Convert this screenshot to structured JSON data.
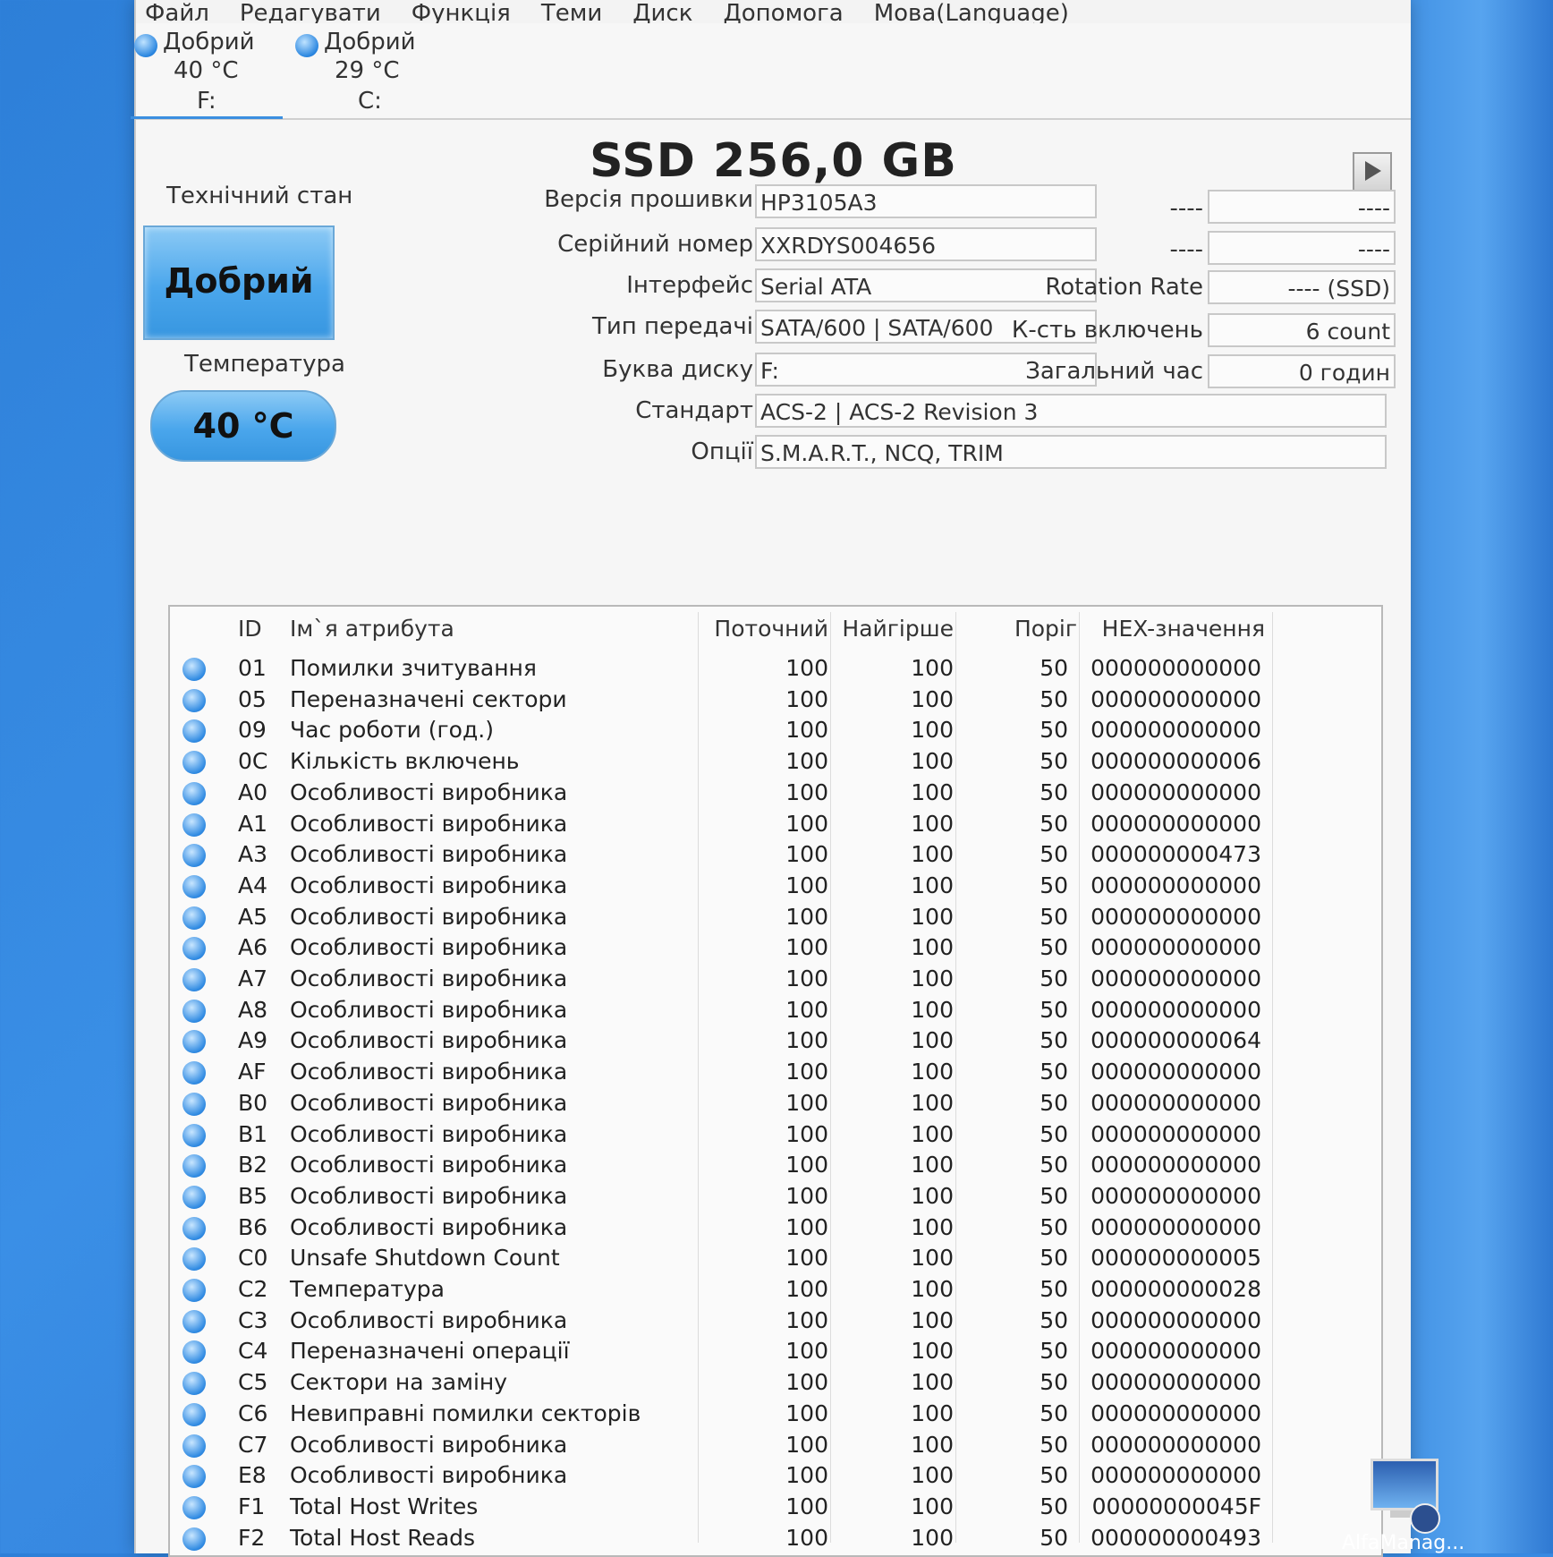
{
  "menu": [
    "Файл",
    "Редагувати",
    "Функція",
    "Теми",
    "Диск",
    "Допомога",
    "Мова(Language)"
  ],
  "drives": [
    {
      "status": "Добрий",
      "temp": "40 °C",
      "letter": "F:"
    },
    {
      "status": "Добрий",
      "temp": "29 °C",
      "letter": "C:"
    }
  ],
  "model": "SSD 256,0 GB",
  "health": {
    "label": "Технічний стан",
    "value": "Добрий"
  },
  "temperature": {
    "label": "Температура",
    "value": "40 °C"
  },
  "info": {
    "firmware_label": "Версія прошивки",
    "firmware": "HP3105A3",
    "serial_label": "Серійний номер",
    "serial": "XXRDYS004656",
    "interface_label": "Інтерфейс",
    "interface": "Serial ATA",
    "transfer_label": "Тип передачі",
    "transfer": "SATA/600 | SATA/600",
    "letter_label": "Буква диску",
    "letter": "F:",
    "standard_label": "Стандарт",
    "standard": "ACS-2 | ACS-2 Revision 3",
    "options_label": "Опції",
    "options": "S.M.A.R.T., NCQ, TRIM",
    "extra1_label": "----",
    "extra1": "----",
    "extra2_label": "----",
    "extra2": "----",
    "rotation_label": "Rotation Rate",
    "rotation": "---- (SSD)",
    "power_count_label": "К-сть включень",
    "power_count": "6 count",
    "total_time_label": "Загальний час",
    "total_time": "0 годин"
  },
  "table": {
    "headers": {
      "id": "ID",
      "name": "Ім`я атрибута",
      "current": "Поточний",
      "worst": "Найгірше",
      "threshold": "Поріг",
      "raw": "HEX-значення"
    },
    "rows": [
      {
        "id": "01",
        "name": "Помилки зчитування",
        "current": "100",
        "worst": "100",
        "threshold": "50",
        "raw": "000000000000"
      },
      {
        "id": "05",
        "name": "Переназначені сектори",
        "current": "100",
        "worst": "100",
        "threshold": "50",
        "raw": "000000000000"
      },
      {
        "id": "09",
        "name": "Час роботи (год.)",
        "current": "100",
        "worst": "100",
        "threshold": "50",
        "raw": "000000000000"
      },
      {
        "id": "0C",
        "name": "Кількість включень",
        "current": "100",
        "worst": "100",
        "threshold": "50",
        "raw": "000000000006"
      },
      {
        "id": "A0",
        "name": "Особливості виробника",
        "current": "100",
        "worst": "100",
        "threshold": "50",
        "raw": "000000000000"
      },
      {
        "id": "A1",
        "name": "Особливості виробника",
        "current": "100",
        "worst": "100",
        "threshold": "50",
        "raw": "000000000000"
      },
      {
        "id": "A3",
        "name": "Особливості виробника",
        "current": "100",
        "worst": "100",
        "threshold": "50",
        "raw": "000000000473"
      },
      {
        "id": "A4",
        "name": "Особливості виробника",
        "current": "100",
        "worst": "100",
        "threshold": "50",
        "raw": "000000000000"
      },
      {
        "id": "A5",
        "name": "Особливості виробника",
        "current": "100",
        "worst": "100",
        "threshold": "50",
        "raw": "000000000000"
      },
      {
        "id": "A6",
        "name": "Особливості виробника",
        "current": "100",
        "worst": "100",
        "threshold": "50",
        "raw": "000000000000"
      },
      {
        "id": "A7",
        "name": "Особливості виробника",
        "current": "100",
        "worst": "100",
        "threshold": "50",
        "raw": "000000000000"
      },
      {
        "id": "A8",
        "name": "Особливості виробника",
        "current": "100",
        "worst": "100",
        "threshold": "50",
        "raw": "000000000000"
      },
      {
        "id": "A9",
        "name": "Особливості виробника",
        "current": "100",
        "worst": "100",
        "threshold": "50",
        "raw": "000000000064"
      },
      {
        "id": "AF",
        "name": "Особливості виробника",
        "current": "100",
        "worst": "100",
        "threshold": "50",
        "raw": "000000000000"
      },
      {
        "id": "B0",
        "name": "Особливості виробника",
        "current": "100",
        "worst": "100",
        "threshold": "50",
        "raw": "000000000000"
      },
      {
        "id": "B1",
        "name": "Особливості виробника",
        "current": "100",
        "worst": "100",
        "threshold": "50",
        "raw": "000000000000"
      },
      {
        "id": "B2",
        "name": "Особливості виробника",
        "current": "100",
        "worst": "100",
        "threshold": "50",
        "raw": "000000000000"
      },
      {
        "id": "B5",
        "name": "Особливості виробника",
        "current": "100",
        "worst": "100",
        "threshold": "50",
        "raw": "000000000000"
      },
      {
        "id": "B6",
        "name": "Особливості виробника",
        "current": "100",
        "worst": "100",
        "threshold": "50",
        "raw": "000000000000"
      },
      {
        "id": "C0",
        "name": "Unsafe Shutdown Count",
        "current": "100",
        "worst": "100",
        "threshold": "50",
        "raw": "000000000005"
      },
      {
        "id": "C2",
        "name": "Температура",
        "current": "100",
        "worst": "100",
        "threshold": "50",
        "raw": "000000000028"
      },
      {
        "id": "C3",
        "name": "Особливості виробника",
        "current": "100",
        "worst": "100",
        "threshold": "50",
        "raw": "000000000000"
      },
      {
        "id": "C4",
        "name": "Переназначені операції",
        "current": "100",
        "worst": "100",
        "threshold": "50",
        "raw": "000000000000"
      },
      {
        "id": "C5",
        "name": "Сектори на заміну",
        "current": "100",
        "worst": "100",
        "threshold": "50",
        "raw": "000000000000"
      },
      {
        "id": "C6",
        "name": "Невиправні помилки секторів",
        "current": "100",
        "worst": "100",
        "threshold": "50",
        "raw": "000000000000"
      },
      {
        "id": "C7",
        "name": "Особливості виробника",
        "current": "100",
        "worst": "100",
        "threshold": "50",
        "raw": "000000000000"
      },
      {
        "id": "E8",
        "name": "Особливості виробника",
        "current": "100",
        "worst": "100",
        "threshold": "50",
        "raw": "000000000000"
      },
      {
        "id": "F1",
        "name": "Total Host Writes",
        "current": "100",
        "worst": "100",
        "threshold": "50",
        "raw": "00000000045F"
      },
      {
        "id": "F2",
        "name": "Total Host Reads",
        "current": "100",
        "worst": "100",
        "threshold": "50",
        "raw": "000000000493"
      }
    ]
  },
  "desktop_icon": {
    "label": "AlfaManag...",
    "icon": "remote-desktop-icon"
  },
  "colors": {
    "accent": "#3b8ee0",
    "status_good": "#4aa6ec"
  }
}
